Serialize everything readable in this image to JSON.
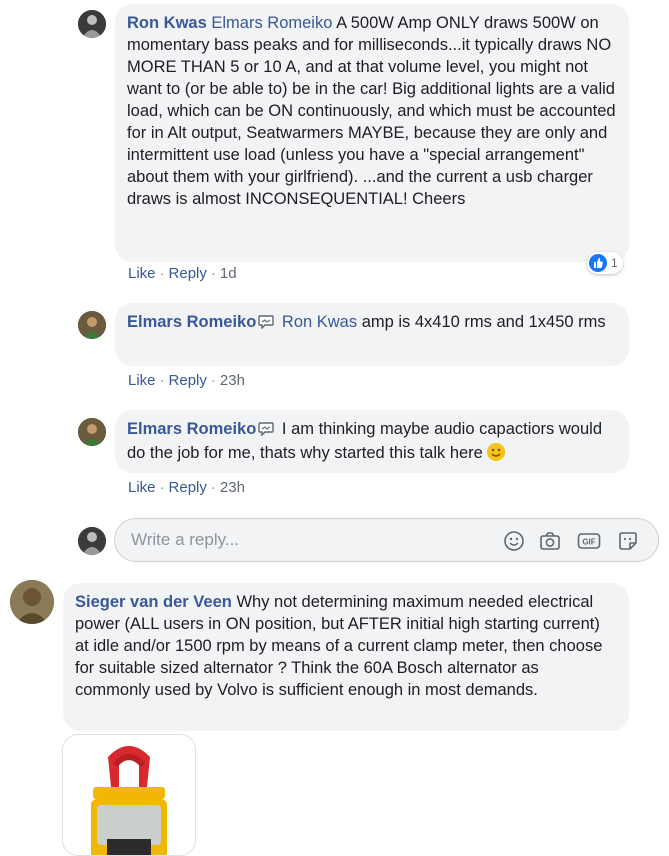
{
  "comments": [
    {
      "author": "Ron Kwas",
      "mention": "Elmars Romeiko",
      "text": "A 500W Amp ONLY draws 500W on momentary bass peaks and for milliseconds...it typically draws NO MORE THAN 5 or 10 A, and at that volume level, you might not want to (or be able to) be in the car! Big additional lights are a valid load, which can be ON continuously, and which must be accounted for in Alt output, Seatwarmers MAYBE, because they are only and intermittent use load (unless you have a \"special arrangement\" about them with your girlfriend). ...and the current a usb charger draws is almost INCONSEQUENTIAL! Cheers",
      "like": "Like",
      "reply": "Reply",
      "time": "1d",
      "reaction_count": "1"
    },
    {
      "author": "Elmars Romeiko",
      "mention": "Ron Kwas",
      "text": "amp is 4x410 rms and 1x450 rms",
      "like": "Like",
      "reply": "Reply",
      "time": "23h"
    },
    {
      "author": "Elmars Romeiko",
      "text": "I am thinking maybe audio capactiors would do the job for me, thats why started this talk here",
      "like": "Like",
      "reply": "Reply",
      "time": "23h"
    }
  ],
  "reply_box": {
    "placeholder": "Write a reply..."
  },
  "icons": {
    "emoji": "smiley-icon",
    "camera": "camera-icon",
    "gif": "gif-icon",
    "sticker": "sticker-icon",
    "gif_label": "GIF"
  },
  "top_comment": {
    "author": "Sieger van der Veen",
    "text": "Why not determining maximum needed electrical power (ALL users in ON position, but AFTER initial high starting current) at idle and/or 1500 rpm by means of a current clamp meter, then choose for suitable sized alternator ? Think the 60A Bosch alternator as commonly used by Volvo is sufficient enough in most demands."
  },
  "colors": {
    "link": "#385898",
    "bubble": "#f2f3f5",
    "like_blue": "#1877f2"
  }
}
